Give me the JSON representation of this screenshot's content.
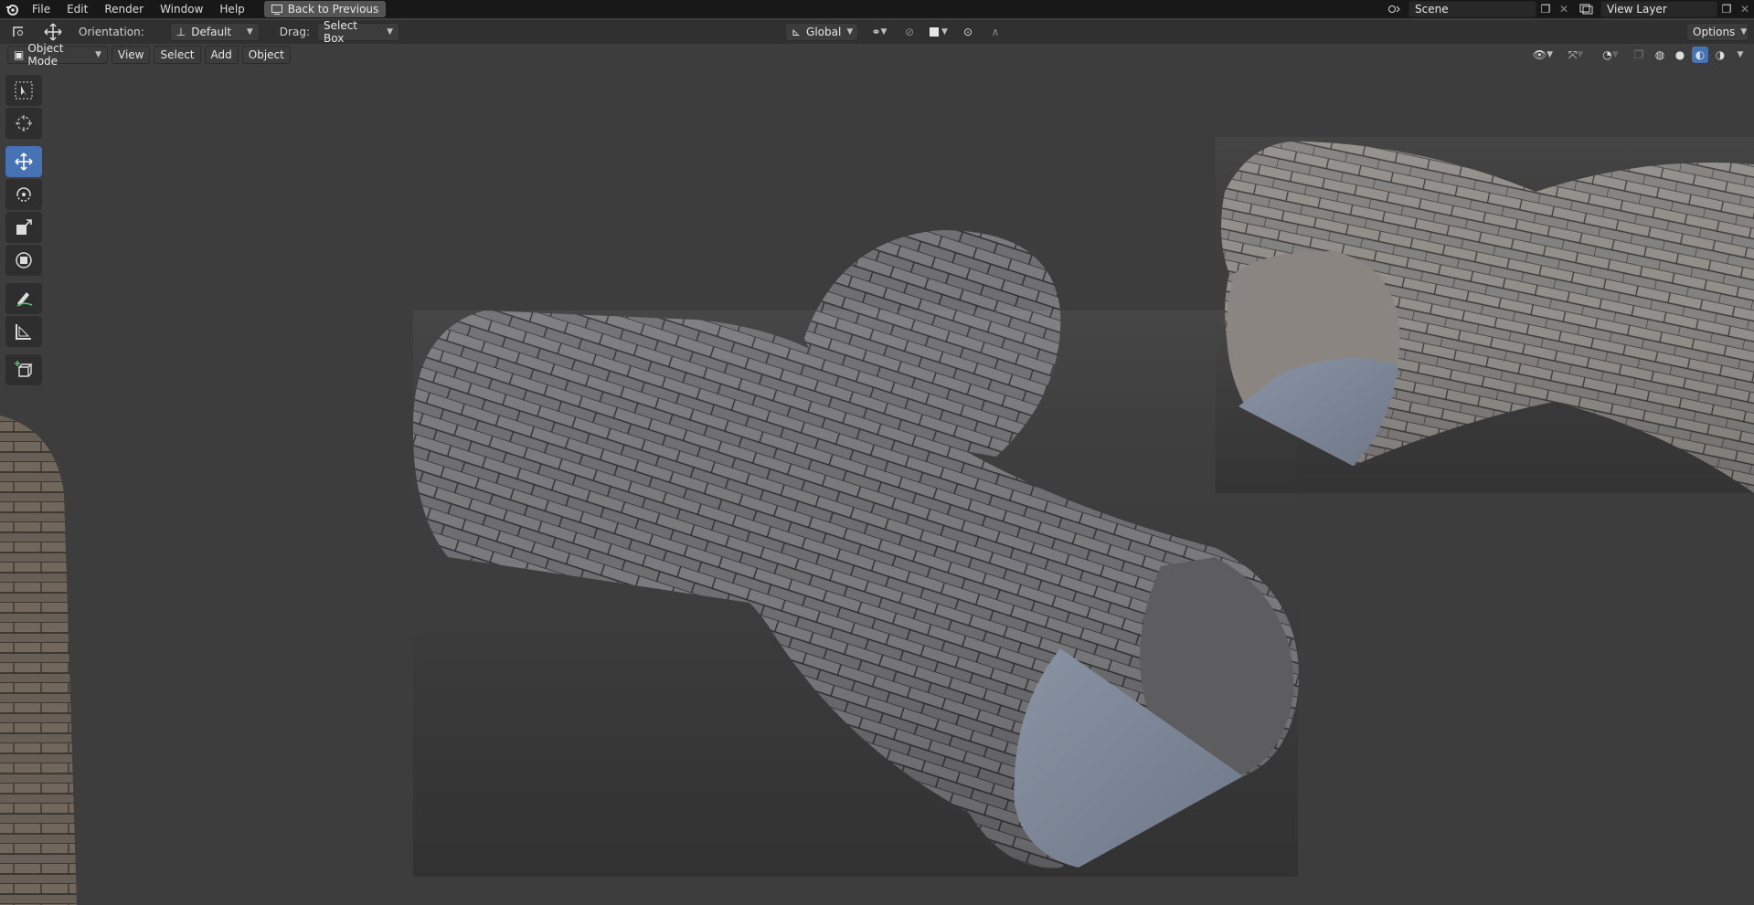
{
  "topbar": {
    "menus": [
      "File",
      "Edit",
      "Render",
      "Window",
      "Help"
    ],
    "back_button": "Back to Previous",
    "scene_name": "Scene",
    "view_layer_name": "View Layer"
  },
  "tool_header": {
    "orientation_label": "Orientation:",
    "orientation_value": "Default",
    "drag_label": "Drag:",
    "drag_value": "Select Box",
    "transform_orientation": "Global",
    "options_label": "Options"
  },
  "view_header": {
    "mode": "Object Mode",
    "menus": [
      "View",
      "Select",
      "Add",
      "Object"
    ]
  },
  "toolbar": {
    "tools": [
      "select-box-icon",
      "cursor-icon",
      "move-icon",
      "rotate-icon",
      "scale-icon",
      "transform-icon",
      "annotate-icon",
      "measure-icon",
      "add-cube-icon"
    ],
    "active_tool": "move-icon"
  },
  "colors": {
    "accent": "#4772b3",
    "background": "#3d3d3d"
  }
}
